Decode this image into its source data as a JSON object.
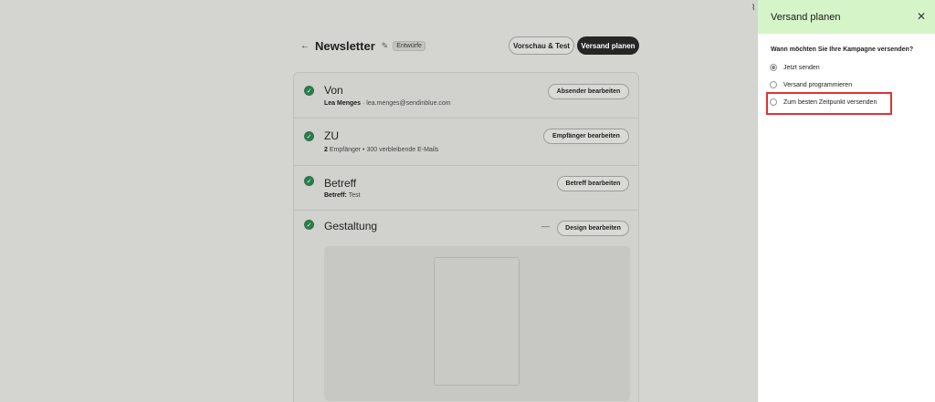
{
  "header": {
    "back_icon": "arrow-left-icon",
    "title": "Newsletter",
    "edit_icon": "pencil-icon",
    "badge": "Entwürfe",
    "preview_test_label": "Vorschau & Test",
    "schedule_label": "Versand planen"
  },
  "sections": {
    "from": {
      "title": "Von",
      "name": "Lea Menges",
      "email": "· lea.menges@sendinblue.com",
      "button": "Absender bearbeiten"
    },
    "to": {
      "title": "ZU",
      "count": "2",
      "detail": "Empfänger • 300 verbleibende E-Mails",
      "button": "Empfänger bearbeiten"
    },
    "subject": {
      "title": "Betreff",
      "label": "Betreff:",
      "value": "Test",
      "button": "Betreff bearbeiten"
    },
    "design": {
      "title": "Gestaltung",
      "dash": "—",
      "button": "Design bearbeiten"
    }
  },
  "panel": {
    "title": "Versand planen",
    "close": "✕",
    "question": "Wann möchten Sie Ihre Kampagne versenden?",
    "options": [
      {
        "label": "Jetzt senden",
        "selected": true
      },
      {
        "label": "Versand programmieren",
        "selected": false
      },
      {
        "label": "Zum besten Zeitpunkt versenden",
        "selected": false
      }
    ],
    "highlight_color": "#e23232",
    "header_color": "#d5f5c8"
  },
  "colors": {
    "check_green": "#2c7a4b",
    "dark_button": "#262626"
  }
}
